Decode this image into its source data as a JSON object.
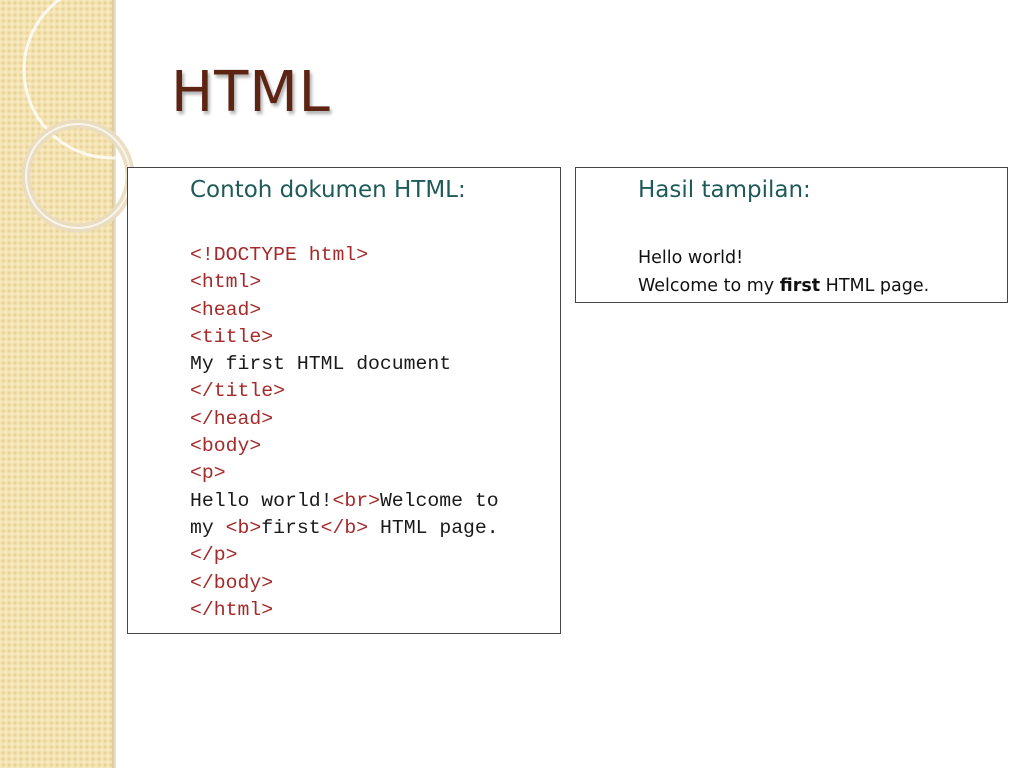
{
  "slide": {
    "title": "HTML"
  },
  "code_panel": {
    "heading": "Contoh dokumen HTML:",
    "lines": [
      [
        {
          "t": "tag",
          "v": "<!DOCTYPE html>"
        }
      ],
      [
        {
          "t": "tag",
          "v": "<html>"
        }
      ],
      [
        {
          "t": "tag",
          "v": "<head>"
        }
      ],
      [
        {
          "t": "tag",
          "v": "<title>"
        }
      ],
      [
        {
          "t": "text",
          "v": "My first HTML document"
        }
      ],
      [
        {
          "t": "tag",
          "v": "</title>"
        }
      ],
      [
        {
          "t": "tag",
          "v": "</head>"
        }
      ],
      [
        {
          "t": "tag",
          "v": "<body>"
        }
      ],
      [
        {
          "t": "tag",
          "v": "<p>"
        }
      ],
      [
        {
          "t": "text",
          "v": "Hello world!"
        },
        {
          "t": "tag",
          "v": "<br>"
        },
        {
          "t": "text",
          "v": "Welcome to"
        }
      ],
      [
        {
          "t": "text",
          "v": "my "
        },
        {
          "t": "tag",
          "v": "<b>"
        },
        {
          "t": "text",
          "v": "first"
        },
        {
          "t": "tag",
          "v": "</b>"
        },
        {
          "t": "text",
          "v": " HTML page."
        }
      ],
      [
        {
          "t": "tag",
          "v": "</p>"
        }
      ],
      [
        {
          "t": "tag",
          "v": "</body>"
        }
      ],
      [
        {
          "t": "tag",
          "v": "</html>"
        }
      ]
    ]
  },
  "result_panel": {
    "heading": "Hasil tampilan:",
    "line1": "Hello world!",
    "line2_before": "Welcome to my ",
    "line2_bold": "first",
    "line2_after": " HTML page."
  },
  "colors": {
    "title": "#5e2413",
    "heading": "#1f5a5a",
    "tag": "#a52a2a",
    "sidebar": "#f3e2b2"
  }
}
